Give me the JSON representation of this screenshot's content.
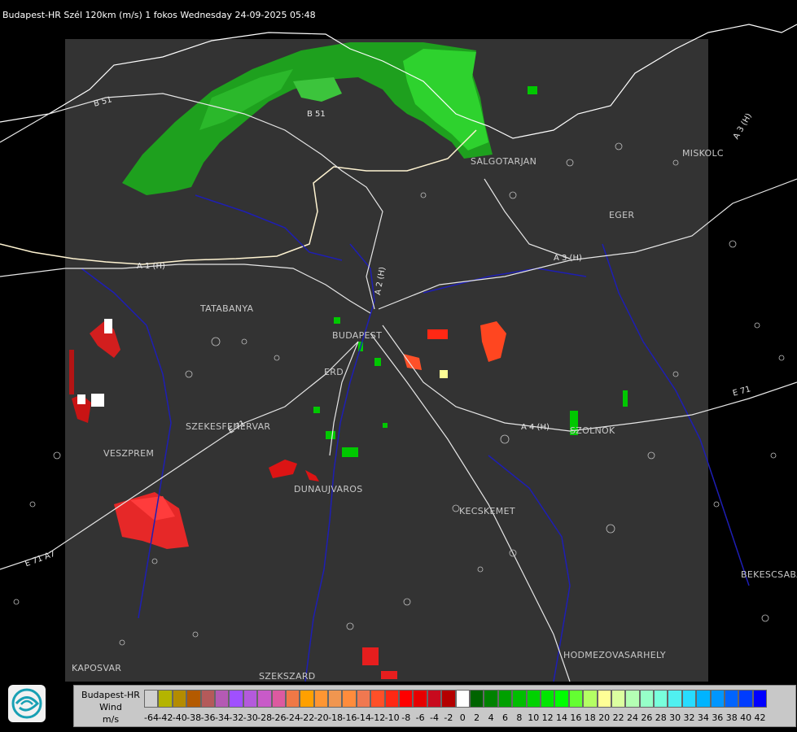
{
  "header": {
    "title": "Budapest-HR Szél 120km (m/s) 1 fokos Wednesday 24-09-2025 05:48"
  },
  "map": {
    "cities": [
      {
        "name": "SALGOTARJAN"
      },
      {
        "name": "MISKOLC"
      },
      {
        "name": "EGER"
      },
      {
        "name": "TATABANYA"
      },
      {
        "name": "BUDAPEST"
      },
      {
        "name": "ERD"
      },
      {
        "name": "SZEKESFEHERVAR"
      },
      {
        "name": "VESZPREM"
      },
      {
        "name": "DUNAUJVAROS"
      },
      {
        "name": "KECSKEMET"
      },
      {
        "name": "SZOLNOK"
      },
      {
        "name": "BEKESCSABA"
      },
      {
        "name": "HODMEZOVASARHELY"
      },
      {
        "name": "KAPOSVAR"
      },
      {
        "name": "SZEKSZARD"
      }
    ],
    "roads": [
      {
        "name": "B 51"
      },
      {
        "name": "B 51"
      },
      {
        "name": "A 3 (H)"
      },
      {
        "name": "A 3 (H)"
      },
      {
        "name": "A 1 (H)"
      },
      {
        "name": "A 2 (H)"
      },
      {
        "name": "A 4 (H)"
      },
      {
        "name": "E 71"
      },
      {
        "name": "E 71"
      },
      {
        "name": "E 71 A7"
      }
    ]
  },
  "legend": {
    "title_lines": [
      "Budapest-HR",
      "Wind",
      "m/s"
    ],
    "entries": [
      {
        "label": "-64",
        "color": "#d0d0d0"
      },
      {
        "label": "-42",
        "color": "#b4b400"
      },
      {
        "label": "-40",
        "color": "#b48c00"
      },
      {
        "label": "-38",
        "color": "#b45a00"
      },
      {
        "label": "-36",
        "color": "#b45a5a"
      },
      {
        "label": "-34",
        "color": "#b45ab4"
      },
      {
        "label": "-32",
        "color": "#a050ff"
      },
      {
        "label": "-30",
        "color": "#b45adc"
      },
      {
        "label": "-28",
        "color": "#c85ac8"
      },
      {
        "label": "-26",
        "color": "#dc5aa0"
      },
      {
        "label": "-24",
        "color": "#f07846"
      },
      {
        "label": "-22",
        "color": "#ffa000"
      },
      {
        "label": "-20",
        "color": "#ff9632"
      },
      {
        "label": "-18",
        "color": "#f09650"
      },
      {
        "label": "-16",
        "color": "#ff8c3c"
      },
      {
        "label": "-14",
        "color": "#f07850"
      },
      {
        "label": "-12",
        "color": "#ff5028"
      },
      {
        "label": "-10",
        "color": "#ff2814"
      },
      {
        "label": "-8",
        "color": "#ff0000"
      },
      {
        "label": "-6",
        "color": "#e60000"
      },
      {
        "label": "-4",
        "color": "#c80a1e"
      },
      {
        "label": "-2",
        "color": "#b40000"
      },
      {
        "label": "0",
        "color": "#ffffff"
      },
      {
        "label": "2",
        "color": "#006400"
      },
      {
        "label": "4",
        "color": "#008200"
      },
      {
        "label": "6",
        "color": "#00a000"
      },
      {
        "label": "8",
        "color": "#00be00"
      },
      {
        "label": "10",
        "color": "#00d200"
      },
      {
        "label": "12",
        "color": "#00e600"
      },
      {
        "label": "14",
        "color": "#00ff00"
      },
      {
        "label": "16",
        "color": "#64ff32"
      },
      {
        "label": "18",
        "color": "#b4ff64"
      },
      {
        "label": "20",
        "color": "#ffff96"
      },
      {
        "label": "22",
        "color": "#dcffa0"
      },
      {
        "label": "24",
        "color": "#b4ffb4"
      },
      {
        "label": "26",
        "color": "#96ffc8"
      },
      {
        "label": "28",
        "color": "#78ffdc"
      },
      {
        "label": "30",
        "color": "#50f0f0"
      },
      {
        "label": "32",
        "color": "#28dcff"
      },
      {
        "label": "34",
        "color": "#00b4ff"
      },
      {
        "label": "36",
        "color": "#0096ff"
      },
      {
        "label": "38",
        "color": "#0064ff"
      },
      {
        "label": "40",
        "color": "#003cff"
      },
      {
        "label": "42",
        "color": "#0000ff"
      }
    ]
  }
}
